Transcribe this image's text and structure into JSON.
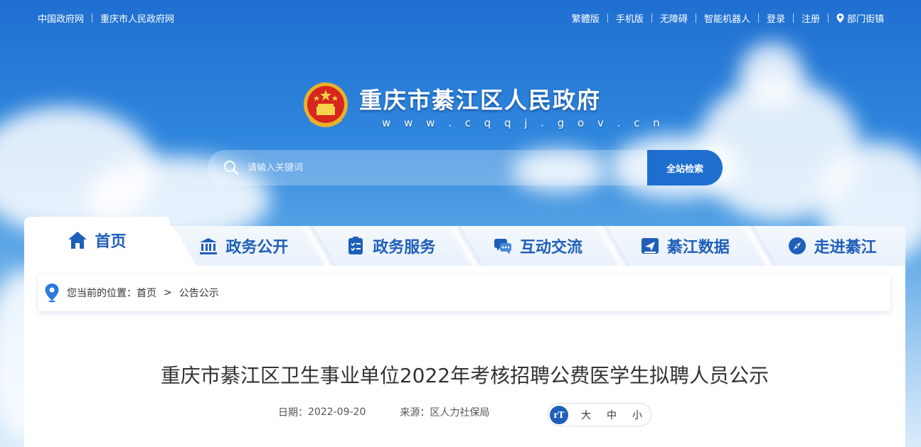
{
  "topbar": {
    "left_links": [
      "中国政府网",
      "重庆市人民政府网"
    ],
    "right_links": [
      "繁體版",
      "手机版",
      "无障碍",
      "智能机器人",
      "登录",
      "注册",
      "部门街镇"
    ]
  },
  "brand": {
    "title": "重庆市綦江区人民政府",
    "url": "w w w . c q q j . g o v . c n"
  },
  "search": {
    "placeholder": "请输入关键词",
    "button_label": "全站检索"
  },
  "nav": {
    "home": "首页",
    "items": [
      "政务公开",
      "政务服务",
      "互动交流",
      "綦江数据",
      "走进綦江"
    ]
  },
  "breadcrumb": {
    "prefix": "您当前的位置：",
    "items": [
      "首页",
      "公告公示"
    ],
    "separator": ">"
  },
  "article": {
    "title": "重庆市綦江区卫生事业单位2022年考核招聘公费医学生拟聘人员公示",
    "date_label": "日期：",
    "date": "2022-09-20",
    "source_label": "来源：",
    "source": "区人力社保局"
  },
  "font_size": {
    "options": [
      "大",
      "中",
      "小"
    ]
  },
  "colors": {
    "accent": "#1f5fb9",
    "sky": "#2f86dd"
  }
}
